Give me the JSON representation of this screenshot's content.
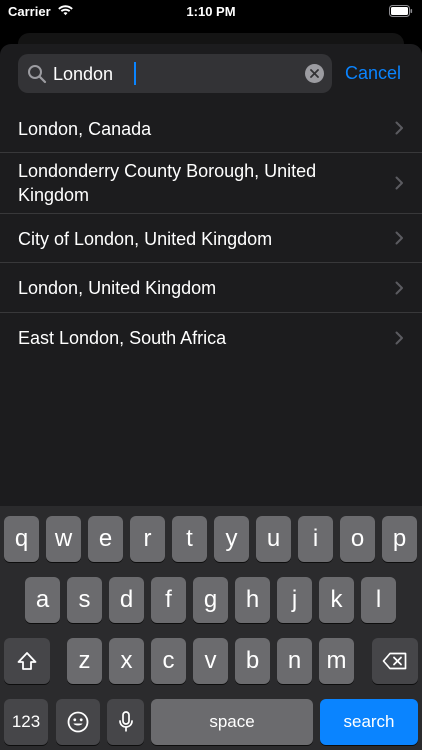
{
  "status_bar": {
    "carrier": "Carrier",
    "time": "1:10 PM"
  },
  "search": {
    "value": "London",
    "cancel_label": "Cancel"
  },
  "results": [
    {
      "label": "London, Canada"
    },
    {
      "label": "Londonderry County Borough, United Kingdom"
    },
    {
      "label": "City of London, United Kingdom"
    },
    {
      "label": "London, United Kingdom"
    },
    {
      "label": "East London, South Africa"
    }
  ],
  "keyboard": {
    "row1": [
      "q",
      "w",
      "e",
      "r",
      "t",
      "y",
      "u",
      "i",
      "o",
      "p"
    ],
    "row2": [
      "a",
      "s",
      "d",
      "f",
      "g",
      "h",
      "j",
      "k",
      "l"
    ],
    "row3": [
      "z",
      "x",
      "c",
      "v",
      "b",
      "n",
      "m"
    ],
    "numbers_label": "123",
    "space_label": "space",
    "search_label": "search"
  },
  "icons": {
    "wifi": "wifi-icon",
    "battery": "battery-icon",
    "search": "search-icon",
    "clear": "clear-icon",
    "chevron": "chevron-right-icon",
    "shift": "shift-icon",
    "delete": "delete-icon",
    "emoji": "emoji-icon",
    "mic": "microphone-icon"
  },
  "colors": {
    "accent": "#0a84ff",
    "sheet": "#1c1c1e",
    "keyboard": "#2b2b2d",
    "key": "#6b6b6e",
    "key_dark": "#464649"
  }
}
